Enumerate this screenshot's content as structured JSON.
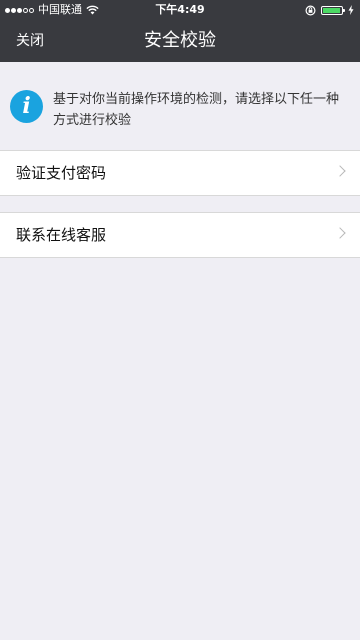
{
  "status_bar": {
    "carrier": "中国联通",
    "time": "下午4:49",
    "signal": {
      "on": 3,
      "total": 5
    },
    "battery_level": 0.95,
    "battery_color": "#4cd964"
  },
  "nav": {
    "close_label": "关闭",
    "title": "安全校验"
  },
  "notice": {
    "icon": "info-icon",
    "text": "基于对你当前操作环境的检测，请选择以下任一种方式进行校验"
  },
  "options": [
    {
      "label": "验证支付密码",
      "icon": "chevron-right-icon"
    },
    {
      "label": "联系在线客服",
      "icon": "chevron-right-icon"
    }
  ],
  "colors": {
    "header_bg": "#393a3f",
    "page_bg": "#efeef4",
    "info_blue": "#1aa3df"
  }
}
